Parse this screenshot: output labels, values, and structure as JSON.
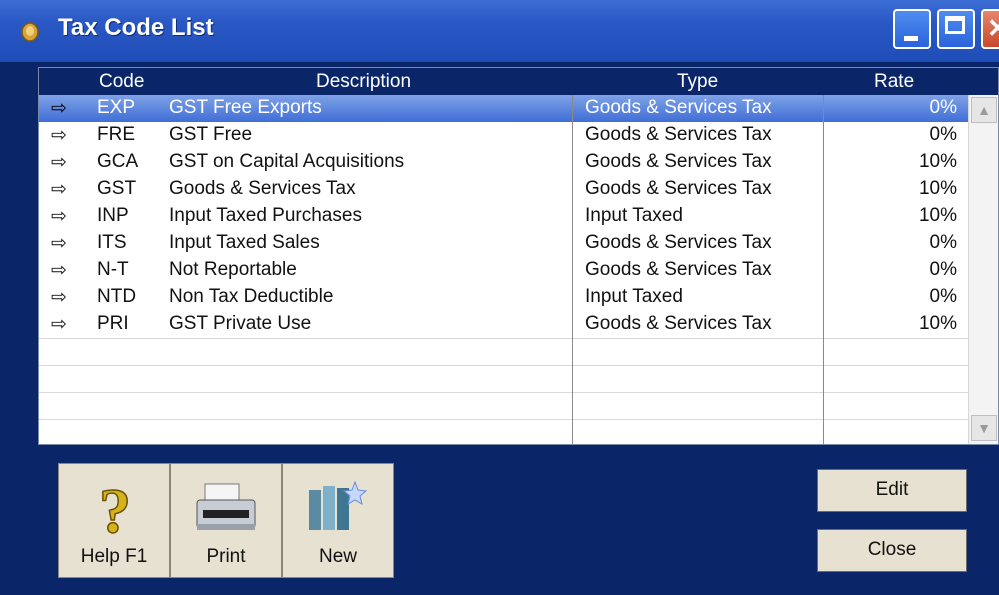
{
  "window": {
    "title": "Tax Code List",
    "title_icon": "coin-icon",
    "controls": [
      "minimize-icon",
      "maximize-icon",
      "close-icon"
    ]
  },
  "table": {
    "columns": [
      "Code",
      "Description",
      "Type",
      "Rate"
    ],
    "rows": [
      {
        "code": "EXP",
        "description": "GST Free Exports",
        "type": "Goods & Services Tax",
        "rate": "0%",
        "selected": true
      },
      {
        "code": "FRE",
        "description": "GST Free",
        "type": "Goods & Services Tax",
        "rate": "0%"
      },
      {
        "code": "GCA",
        "description": "GST on Capital Acquisitions",
        "type": "Goods & Services Tax",
        "rate": "10%"
      },
      {
        "code": "GST",
        "description": "Goods & Services Tax",
        "type": "Goods & Services Tax",
        "rate": "10%"
      },
      {
        "code": "INP",
        "description": "Input Taxed Purchases",
        "type": "Input Taxed",
        "rate": "10%"
      },
      {
        "code": "ITS",
        "description": "Input Taxed Sales",
        "type": "Goods & Services Tax",
        "rate": "0%"
      },
      {
        "code": "N-T",
        "description": "Not Reportable",
        "type": "Goods & Services Tax",
        "rate": "0%"
      },
      {
        "code": "NTD",
        "description": "Non Tax Deductible",
        "type": "Input Taxed",
        "rate": "0%"
      },
      {
        "code": "PRI",
        "description": "GST Private Use",
        "type": "Goods & Services Tax",
        "rate": "10%"
      }
    ],
    "row_arrow_icon": "arrow-right-icon"
  },
  "toolbar": {
    "help_label": "Help F1",
    "print_label": "Print",
    "new_label": "New",
    "help_icon": "question-mark-icon",
    "print_icon": "printer-icon",
    "new_icon": "new-document-icon"
  },
  "actions": {
    "edit_label": "Edit",
    "close_label": "Close"
  },
  "colors": {
    "window_bg": "#0a2669",
    "titlebar": "#2a58c4",
    "selection": "#3f6ed6",
    "button_face": "#e6e1d1"
  }
}
